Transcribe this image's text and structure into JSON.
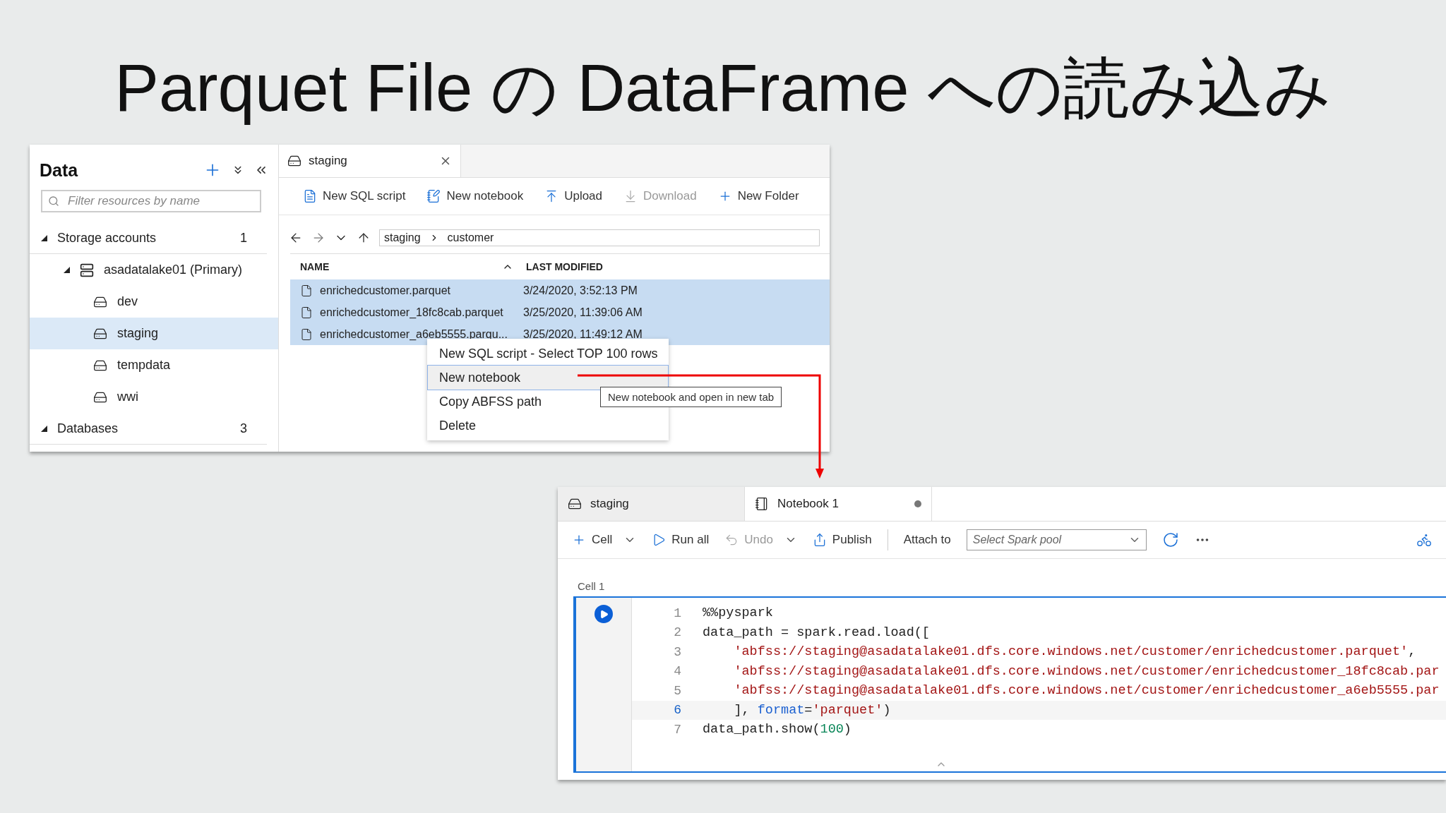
{
  "title": "Parquet File の DataFrame への読み込み",
  "data_panel": {
    "title": "Data",
    "filter_placeholder": "Filter resources by name",
    "tree": [
      {
        "label": "Storage accounts",
        "count": "1",
        "kind": "section",
        "expanded": true,
        "selected": false,
        "children": [
          {
            "label": "asadatalake01 (Primary)",
            "kind": "account",
            "expanded": true,
            "selected": false,
            "children": [
              {
                "label": "dev",
                "kind": "container",
                "selected": false
              },
              {
                "label": "staging",
                "kind": "container",
                "selected": true
              },
              {
                "label": "tempdata",
                "kind": "container",
                "selected": false
              },
              {
                "label": "wwi",
                "kind": "container",
                "selected": false
              }
            ]
          }
        ]
      },
      {
        "label": "Databases",
        "count": "3",
        "kind": "section",
        "expanded": true,
        "selected": false
      }
    ]
  },
  "explorer": {
    "tab": {
      "label": "staging"
    },
    "toolbar": [
      {
        "label": "New SQL script",
        "disabled": false
      },
      {
        "label": "New notebook",
        "disabled": false
      },
      {
        "label": "Upload",
        "disabled": false
      },
      {
        "label": "Download",
        "disabled": true
      },
      {
        "label": "New Folder",
        "disabled": false
      }
    ],
    "breadcrumb": [
      "staging",
      "customer"
    ],
    "columns": [
      "NAME",
      "LAST MODIFIED"
    ],
    "rows": [
      {
        "name": "enrichedcustomer.parquet",
        "modified": "3/24/2020, 3:52:13 PM",
        "selected": true
      },
      {
        "name": "enrichedcustomer_18fc8cab.parquet",
        "modified": "3/25/2020, 11:39:06 AM",
        "selected": true
      },
      {
        "name": "enrichedcustomer_a6eb5555.parqu...",
        "modified": "3/25/2020, 11:49:12 AM",
        "selected": true
      }
    ],
    "context_menu": [
      {
        "label": "New SQL script - Select TOP 100 rows",
        "selected": false
      },
      {
        "label": "New notebook",
        "selected": true
      },
      {
        "label": "Copy ABFSS path",
        "selected": false
      },
      {
        "label": "Delete",
        "selected": false
      }
    ],
    "tooltip": "New notebook and open in new tab"
  },
  "notebook": {
    "tabs": [
      {
        "label": "staging",
        "selected": false,
        "unsaved": false
      },
      {
        "label": "Notebook 1",
        "selected": true,
        "unsaved": true
      }
    ],
    "toolbar": [
      {
        "label": "Cell",
        "caret": true,
        "disabled": false
      },
      {
        "label": "Run all",
        "caret": false,
        "disabled": false
      },
      {
        "label": "Undo",
        "caret": true,
        "disabled": true
      },
      {
        "label": "Publish",
        "caret": false,
        "disabled": false
      }
    ],
    "attach_label": "Attach to",
    "pool_placeholder": "Select Spark pool",
    "cell_label": "Cell 1",
    "code": [
      {
        "number": "1",
        "current": false,
        "tokens": [
          {
            "kind": "plain",
            "text": "%%pyspark"
          }
        ]
      },
      {
        "number": "2",
        "current": false,
        "tokens": [
          {
            "kind": "plain",
            "text": "data_path = spark.read.load(["
          }
        ]
      },
      {
        "number": "3",
        "current": false,
        "tokens": [
          {
            "kind": "string",
            "text": "    'abfss://staging@asadatalake01.dfs.core.windows.net/customer/enrichedcustomer.parquet'"
          },
          {
            "kind": "plain",
            "text": ","
          }
        ]
      },
      {
        "number": "4",
        "current": false,
        "tokens": [
          {
            "kind": "string",
            "text": "    'abfss://staging@asadatalake01.dfs.core.windows.net/customer/enrichedcustomer_18fc8cab.par"
          }
        ]
      },
      {
        "number": "5",
        "current": false,
        "tokens": [
          {
            "kind": "string",
            "text": "    'abfss://staging@asadatalake01.dfs.core.windows.net/customer/enrichedcustomer_a6eb5555.par"
          }
        ]
      },
      {
        "number": "6",
        "current": true,
        "tokens": [
          {
            "kind": "plain",
            "text": "    ], "
          },
          {
            "kind": "keyword",
            "text": "format"
          },
          {
            "kind": "plain",
            "text": "="
          },
          {
            "kind": "string",
            "text": "'parquet'"
          },
          {
            "kind": "plain",
            "text": ")"
          }
        ]
      },
      {
        "number": "7",
        "current": false,
        "tokens": [
          {
            "kind": "plain",
            "text": "data_path.show("
          },
          {
            "kind": "number",
            "text": "100"
          },
          {
            "kind": "plain",
            "text": ")"
          }
        ]
      }
    ]
  }
}
